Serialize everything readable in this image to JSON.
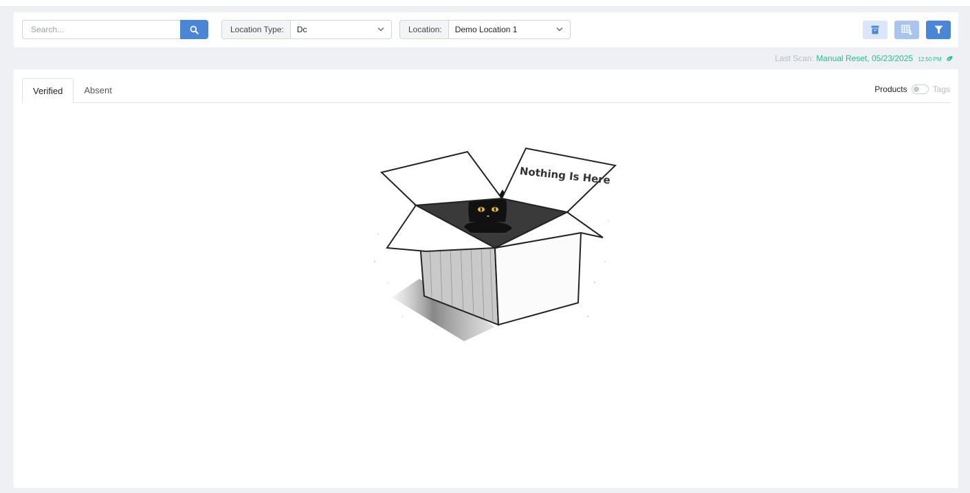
{
  "toolbar": {
    "search_placeholder": "Search...",
    "location_type_label": "Location Type:",
    "location_type_value": "Dc",
    "location_label": "Location:",
    "location_value": "Demo Location 1",
    "icons": [
      "search-icon",
      "archive-icon",
      "export-excel-icon",
      "filter-icon"
    ]
  },
  "scan": {
    "label": "Last Scan:",
    "value": "Manual Reset, 05/23/2025",
    "time": "12:50 PM",
    "icon": "leaf-icon"
  },
  "tabs": [
    {
      "label": "Verified",
      "active": true
    },
    {
      "label": "Absent",
      "active": false
    }
  ],
  "toggle": {
    "left_label": "Products",
    "right_label": "Tags",
    "on": false
  },
  "empty_state": {
    "text": "Nothing Is Here"
  },
  "colors": {
    "primary": "#4a86d8",
    "primary_light": "#dbe6f8",
    "success": "#1fc38c",
    "background": "#eef0f4"
  }
}
